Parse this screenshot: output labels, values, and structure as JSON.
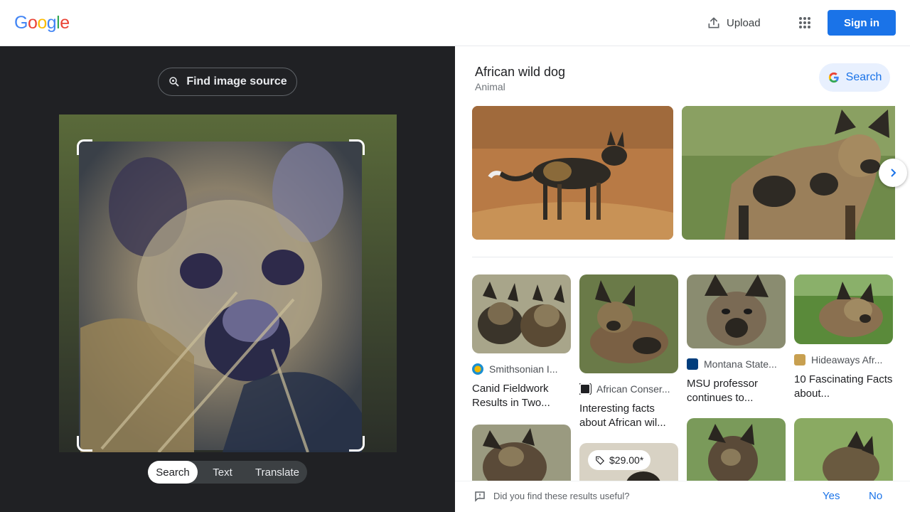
{
  "header": {
    "logo_letters": [
      "G",
      "o",
      "o",
      "g",
      "l",
      "e"
    ],
    "logo_colors": [
      "#4285f4",
      "#ea4335",
      "#fbbc05",
      "#4285f4",
      "#34a853",
      "#ea4335"
    ],
    "upload_label": "Upload",
    "apps_icon": "apps-grid-icon",
    "signin_label": "Sign in"
  },
  "left_panel": {
    "find_source_label": "Find image source",
    "modes": [
      {
        "label": "Search",
        "active": true
      },
      {
        "label": "Text",
        "active": false
      },
      {
        "label": "Translate",
        "active": false
      }
    ]
  },
  "right_panel": {
    "entity": {
      "title": "African wild dog",
      "subtitle": "Animal"
    },
    "search_button_label": "Search",
    "results": [
      {
        "source": "Smithsonian I...",
        "title": "Canid Fieldwork Results in Two..."
      },
      {
        "source": "African Conser...",
        "title": "Interesting facts about African wil..."
      },
      {
        "source": "Montana State...",
        "title": "MSU professor continues to..."
      },
      {
        "source": "Hideaways Afr...",
        "title": "10 Fascinating Facts about..."
      }
    ],
    "price_badge": "$29.00*",
    "feedback": {
      "question": "Did you find these results useful?",
      "yes": "Yes",
      "no": "No"
    }
  },
  "colors": {
    "brand_blue": "#1a73e8",
    "dark_panel": "#202124"
  }
}
